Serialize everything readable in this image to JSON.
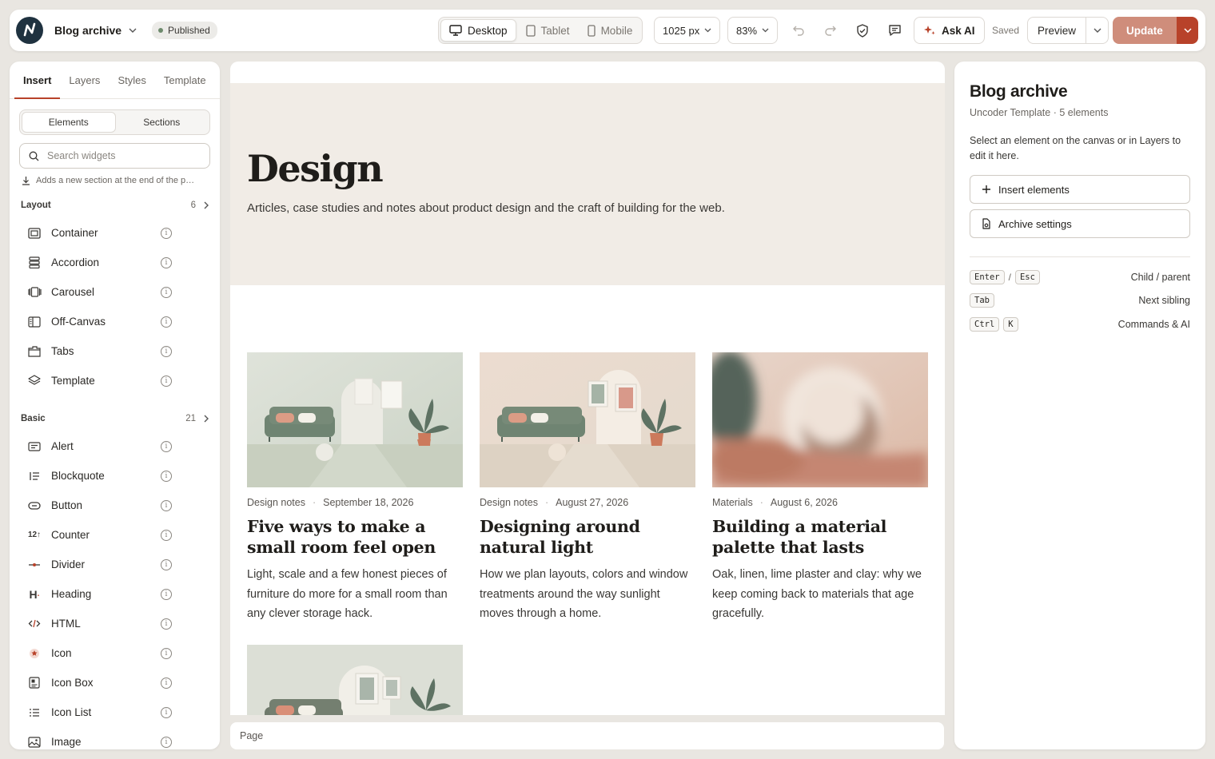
{
  "app": {
    "page_title": "Blog archive",
    "status": "Published"
  },
  "toolbar": {
    "devices": [
      {
        "label": "Desktop"
      },
      {
        "label": "Tablet"
      },
      {
        "label": "Mobile"
      }
    ],
    "width": "1025 px",
    "zoom": "83%",
    "ask_ai": "Ask AI",
    "saved": "Saved",
    "preview": "Preview",
    "update": "Update"
  },
  "left": {
    "tabs": [
      "Insert",
      "Layers",
      "Styles",
      "Template"
    ],
    "seg": [
      "Elements",
      "Sections"
    ],
    "search_placeholder": "Search widgets",
    "hint": "Adds a new section at the end of the p…",
    "layout": {
      "title": "Layout",
      "count": "6",
      "items": [
        "Container",
        "Accordion",
        "Carousel",
        "Off-Canvas",
        "Tabs",
        "Template"
      ]
    },
    "basic": {
      "title": "Basic",
      "count": "21",
      "items": [
        "Alert",
        "Blockquote",
        "Button",
        "Counter",
        "Divider",
        "Heading",
        "HTML",
        "Icon",
        "Icon Box",
        "Icon List",
        "Image"
      ]
    }
  },
  "canvas": {
    "hero_title": "Design",
    "hero_sub": "Articles, case studies and notes about product design and the craft of building for the web.",
    "cards": [
      {
        "category": "Design notes",
        "date": "September 18, 2026",
        "title": "Five ways to make a small room feel open",
        "excerpt": "Light, scale and a few honest pieces of furniture do more for a small room than any clever storage hack."
      },
      {
        "category": "Design notes",
        "date": "August 27, 2026",
        "title": "Designing around natural light",
        "excerpt": "How we plan layouts, colors and window treatments around the way sunlight moves through a home."
      },
      {
        "category": "Materials",
        "date": "August 6, 2026",
        "title": "Building a material palette that lasts",
        "excerpt": "Oak, linen, lime plaster and clay: why we keep coming back to materials that age gracefully."
      }
    ],
    "page_label": "Page"
  },
  "right": {
    "title": "Blog archive",
    "sub": "Uncoder Template · 5 elements",
    "desc": "Select an element on the canvas or in Layers to edit it here.",
    "btn_insert": "Insert elements",
    "btn_settings": "Archive settings",
    "shortcuts": [
      {
        "keys": [
          "Enter",
          "Esc"
        ],
        "sep": "/",
        "label": "Child / parent"
      },
      {
        "keys": [
          "Tab"
        ],
        "label": "Next sibling"
      },
      {
        "keys": [
          "Ctrl",
          "K"
        ],
        "label": "Commands & AI"
      }
    ]
  },
  "colors": {
    "accent": "#b8422a",
    "update_bg": "#cf8d7b",
    "hero_bg": "#f1ece6"
  }
}
